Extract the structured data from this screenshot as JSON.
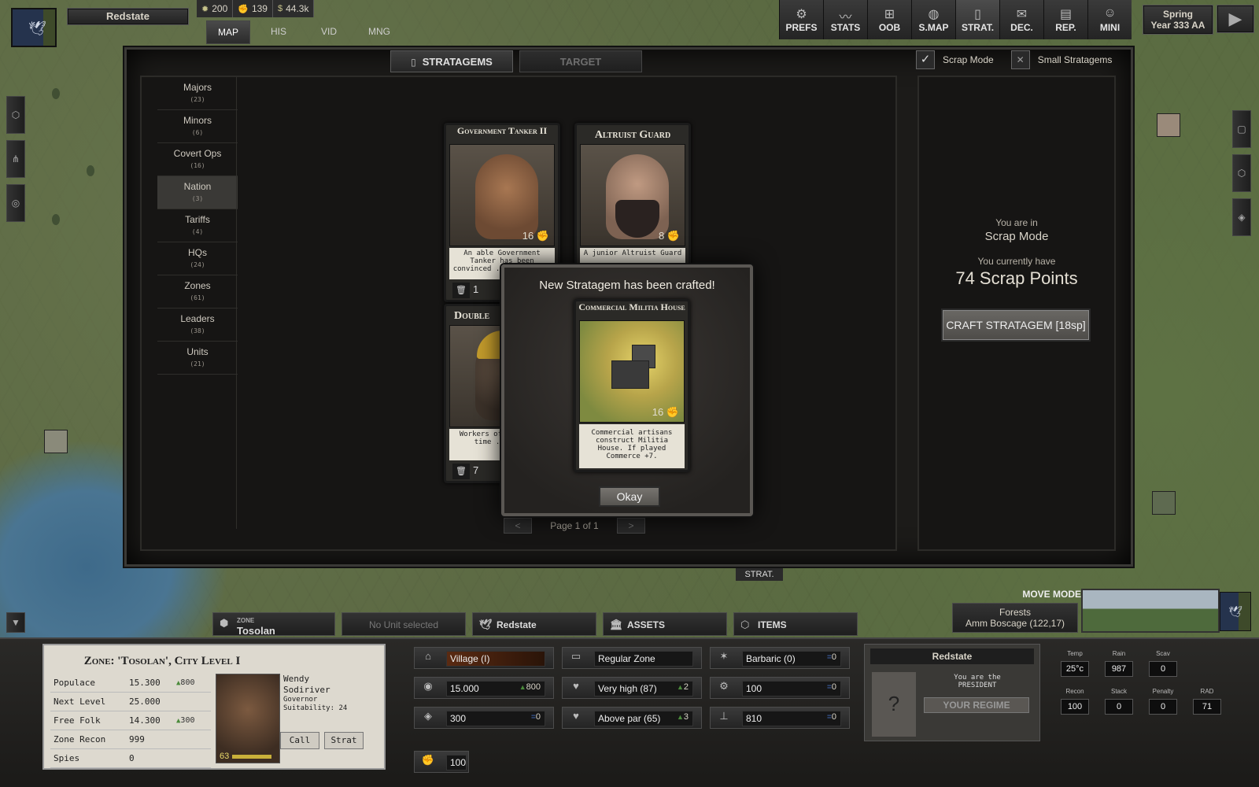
{
  "top": {
    "nation": "Redstate",
    "resources": [
      {
        "icon": "sun-icon",
        "value": "200"
      },
      {
        "icon": "fist-icon",
        "value": "139"
      },
      {
        "icon": "cash-icon",
        "value": "44.3k"
      }
    ],
    "left_tabs": [
      "MAP",
      "HIS",
      "VID",
      "MNG"
    ],
    "nav": [
      {
        "label": "PREFS",
        "icon": "gear-icon",
        "glyph": "⚙"
      },
      {
        "label": "STATS",
        "icon": "chart-icon",
        "glyph": "📈"
      },
      {
        "label": "OOB",
        "icon": "hierarchy-icon",
        "glyph": "⊞"
      },
      {
        "label": "S.MAP",
        "icon": "globe-icon",
        "glyph": "🌐"
      },
      {
        "label": "STRAT.",
        "icon": "card-icon",
        "glyph": "▯"
      },
      {
        "label": "DEC.",
        "icon": "mail-icon",
        "glyph": "✉"
      },
      {
        "label": "REP.",
        "icon": "document-icon",
        "glyph": "▤"
      },
      {
        "label": "MINI",
        "icon": "person-icon",
        "glyph": "☺"
      }
    ],
    "season": "Spring",
    "year": "Year 333 AA"
  },
  "stratagems": {
    "tabs": [
      "STRATAGEMS",
      "TARGET"
    ],
    "scrap_mode_label": "Scrap Mode",
    "small_label": "Small Stratagems",
    "categories": [
      {
        "name": "Majors",
        "count": "(23)"
      },
      {
        "name": "Minors",
        "count": "(6)"
      },
      {
        "name": "Covert Ops",
        "count": "(16)"
      },
      {
        "name": "Nation",
        "count": "(3)"
      },
      {
        "name": "Tariffs",
        "count": "(4)"
      },
      {
        "name": "HQs",
        "count": "(24)"
      },
      {
        "name": "Zones",
        "count": "(61)"
      },
      {
        "name": "Leaders",
        "count": "(38)"
      },
      {
        "name": "Units",
        "count": "(21)"
      }
    ],
    "cards": [
      {
        "title": "Government Tanker II",
        "cost": "16",
        "text": "An able Government Tanker has been convinced ... If played",
        "bottom": "1"
      },
      {
        "title": "Altruist Guard",
        "cost": "8",
        "text": "A junior Altruist Guard",
        "bottom": ""
      },
      {
        "title": "Double",
        "cost": "",
        "text": "Workers of ... It is time ... more",
        "bottom": "7"
      }
    ],
    "pager": "Page 1 of 1",
    "prev": "<",
    "next": ">"
  },
  "scrap": {
    "line1": "You are in",
    "line2": "Scrap Mode",
    "line3": "You currently have",
    "points": "74 Scrap Points",
    "craft_button": "CRAFT STRATAGEM [18sp]"
  },
  "modal": {
    "title": "New Stratagem has been crafted!",
    "card_title": "Commercial Militia House",
    "card_cost": "16",
    "card_text": "Commercial artisans construct Militia House. If played Commerce +7.",
    "okay": "Okay"
  },
  "map_strat_label": "STRAT.",
  "bottom_tabs": {
    "zone_small": "ZONE",
    "zone_name": "Tosolan",
    "no_unit": "No Unit selected",
    "nation": "Redstate",
    "assets": "ASSETS",
    "items": "ITEMS"
  },
  "move_mode": "MOVE MODE",
  "terrain": {
    "name": "Forests",
    "place": "Amm Boscage (122,17)"
  },
  "zone": {
    "title": "Zone: 'Tosolan', City Level I",
    "rows": [
      {
        "label": "Populace",
        "value": "15.300",
        "delta": "800"
      },
      {
        "label": "Next Level",
        "value": "25.000",
        "delta": ""
      },
      {
        "label": "Free Folk",
        "value": "14.300",
        "delta": "300"
      },
      {
        "label": "Zone Recon",
        "value": "999",
        "delta": ""
      },
      {
        "label": "Spies",
        "value": "0",
        "delta": ""
      }
    ],
    "governor_first": "Wendy",
    "governor_last": "Sodiriver",
    "governor_role": "Governor",
    "suitability": "Suitability: 24",
    "portrait_level": "63",
    "call": "Call",
    "strat": "Strat"
  },
  "mid": {
    "c1": [
      {
        "icon": "village-icon",
        "glyph": "⌂",
        "value": "Village (I)",
        "delta": ""
      },
      {
        "icon": "population-icon",
        "glyph": "◉",
        "value": "15.000",
        "delta": "800"
      },
      {
        "icon": "soldier-icon",
        "glyph": "◈",
        "value": "300",
        "delta": "0"
      }
    ],
    "c2": [
      {
        "icon": "zone-icon",
        "glyph": "▭",
        "value": "Regular Zone",
        "delta": ""
      },
      {
        "icon": "heart-icon",
        "glyph": "♥",
        "value": "Very high (87)",
        "delta": "2"
      },
      {
        "icon": "heart-icon",
        "glyph": "♥",
        "value": "Above par (65)",
        "delta": "3"
      }
    ],
    "c3": [
      {
        "icon": "barbaric-icon",
        "glyph": "✶",
        "value": "Barbaric (0)",
        "delta": "0"
      },
      {
        "icon": "gear-icon",
        "glyph": "⚙",
        "value": "100",
        "delta": "0"
      },
      {
        "icon": "road-icon",
        "glyph": "⊥",
        "value": "810",
        "delta": "0"
      }
    ],
    "fist_value": "100"
  },
  "regime": {
    "name": "Redstate",
    "line1": "You are the",
    "line2": "PRESIDENT",
    "button": "YOUR REGIME",
    "unknown": "?"
  },
  "weather": [
    {
      "label": "Temp",
      "value": "25°c"
    },
    {
      "label": "Rain",
      "value": "987"
    },
    {
      "label": "Scav",
      "value": "0"
    },
    {
      "label": "Recon",
      "value": "100"
    },
    {
      "label": "Stack",
      "value": "0"
    },
    {
      "label": "Penalty",
      "value": "0"
    },
    {
      "label": "RAD",
      "value": "71"
    }
  ]
}
